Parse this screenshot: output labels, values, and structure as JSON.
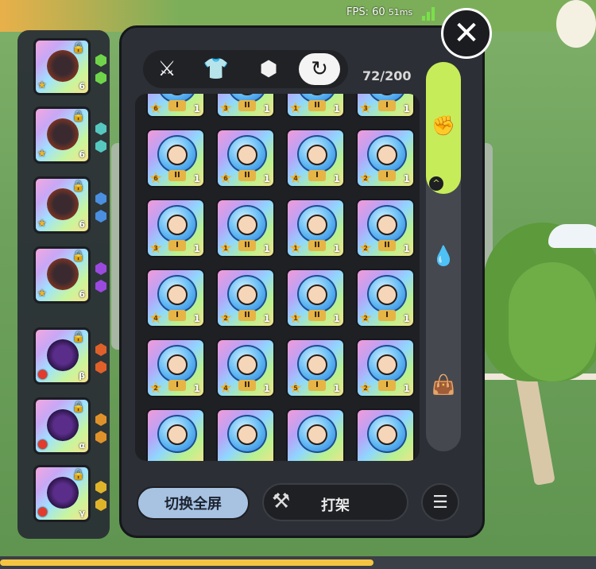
{
  "status": {
    "fps_label": "FPS: 60",
    "latency": "51ms"
  },
  "header": {
    "count": "72/200"
  },
  "tabs": [
    {
      "icon": "crossed-swords-icon",
      "glyph": "⚔"
    },
    {
      "icon": "armor-icon",
      "glyph": "👕"
    },
    {
      "icon": "gem-icon",
      "glyph": "⬢"
    },
    {
      "icon": "swirl-pet-icon",
      "glyph": "↻",
      "active": true
    }
  ],
  "side_filters": [
    {
      "icon": "fist-icon",
      "glyph": "✊",
      "active": true
    },
    {
      "icon": "drop-icon",
      "glyph": "💧"
    },
    {
      "icon": "bag-icon",
      "glyph": "👜"
    }
  ],
  "equipment": [
    {
      "level": "6",
      "rank": "★"
    },
    {
      "level": "6",
      "rank": "★"
    },
    {
      "level": "6",
      "rank": "★"
    },
    {
      "level": "6",
      "rank": "★"
    },
    {
      "level": "β",
      "rank": "●"
    },
    {
      "level": "α",
      "rank": "●"
    },
    {
      "level": "γ",
      "rank": "●"
    }
  ],
  "cards": [
    {
      "star": "6",
      "tier": "I",
      "level": "1"
    },
    {
      "star": "3",
      "tier": "II",
      "level": "1"
    },
    {
      "star": "1",
      "tier": "II",
      "level": "1"
    },
    {
      "star": "3",
      "tier": "I",
      "level": "1"
    },
    {
      "star": "6",
      "tier": "II",
      "level": "1"
    },
    {
      "star": "6",
      "tier": "II",
      "level": "1"
    },
    {
      "star": "4",
      "tier": "I",
      "level": "1"
    },
    {
      "star": "2",
      "tier": "I",
      "level": "1"
    },
    {
      "star": "3",
      "tier": "I",
      "level": "1"
    },
    {
      "star": "1",
      "tier": "II",
      "level": "1"
    },
    {
      "star": "1",
      "tier": "II",
      "level": "1"
    },
    {
      "star": "2",
      "tier": "II",
      "level": "1"
    },
    {
      "star": "4",
      "tier": "I",
      "level": "1"
    },
    {
      "star": "2",
      "tier": "II",
      "level": "1"
    },
    {
      "star": "1",
      "tier": "II",
      "level": "1"
    },
    {
      "star": "2",
      "tier": "I",
      "level": "1"
    },
    {
      "star": "2",
      "tier": "I",
      "level": "1"
    },
    {
      "star": "4",
      "tier": "II",
      "level": "1"
    },
    {
      "star": "5",
      "tier": "I",
      "level": "1"
    },
    {
      "star": "2",
      "tier": "I",
      "level": "1"
    },
    {
      "star": "",
      "tier": "",
      "level": ""
    },
    {
      "star": "",
      "tier": "",
      "level": ""
    },
    {
      "star": "",
      "tier": "",
      "level": ""
    },
    {
      "star": "",
      "tier": "",
      "level": ""
    }
  ],
  "buttons": {
    "fullscreen": "切换全屏",
    "fight": "打架"
  },
  "colors": {
    "panel": "#2c2f35",
    "accent": "#c6ec5a",
    "fullscreen_btn": "#a8c2e2"
  }
}
